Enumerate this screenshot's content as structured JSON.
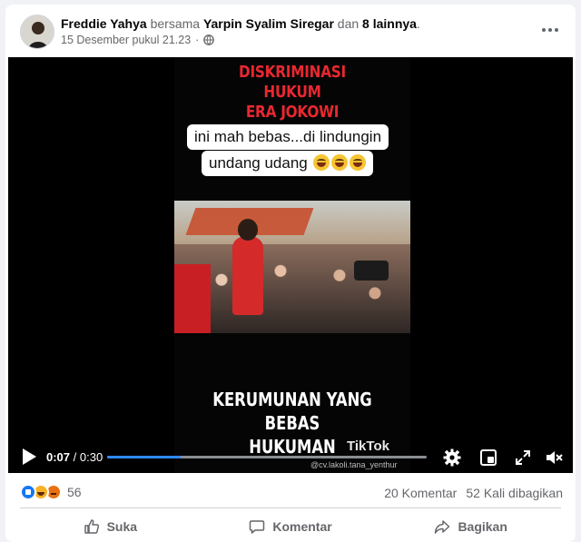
{
  "post": {
    "author": "Freddie Yahya",
    "with_text": "bersama",
    "tagged": "Yarpin Syalim Siregar",
    "and_text": "dan",
    "others": "8 lainnya",
    "suffix": ".",
    "timestamp": "15 Desember pukul 21.23",
    "separator": "·",
    "privacy_icon": "globe-icon"
  },
  "video": {
    "red_title_lines": [
      "DISKRIMINASI",
      "HUKUM",
      "ERA JOKOWI"
    ],
    "caption_line1": "ini mah bebas...di lindungin",
    "caption_line2": "undang udang",
    "bottom_title_lines": [
      "KERUMUNAN YANG BEBAS",
      "HUKUMAN"
    ],
    "watermark": "TikTok",
    "watermark_handle": "@cv.lakoli.tana_yenthur",
    "current_time": "0:07",
    "time_separator": " / ",
    "duration": "0:30",
    "progress_fraction": 0.23
  },
  "stats": {
    "reaction_count": "56",
    "comments": "20 Komentar",
    "shares": "52 Kali dibagikan"
  },
  "actions": {
    "like": "Suka",
    "comment": "Komentar",
    "share": "Bagikan"
  },
  "colors": {
    "accent": "#1877f2",
    "progress": "#2d88ff",
    "title_red": "#e8282f"
  }
}
